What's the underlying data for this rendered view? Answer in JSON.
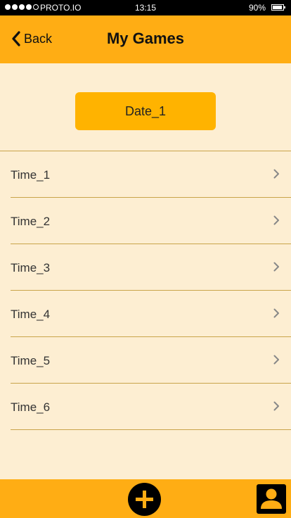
{
  "status_bar": {
    "carrier": "PROTO.IO",
    "time": "13:15",
    "battery": "90%",
    "battery_level": 0.9,
    "signal_bars": 4
  },
  "nav": {
    "back_label": "Back",
    "title": "My Games"
  },
  "date_button": {
    "label": "Date_1"
  },
  "times": [
    {
      "label": "Time_1"
    },
    {
      "label": "Time_2"
    },
    {
      "label": "Time_3"
    },
    {
      "label": "Time_4"
    },
    {
      "label": "Time_5"
    },
    {
      "label": "Time_6"
    }
  ],
  "tab_bar": {
    "add_icon": "plus-circle-icon",
    "profile_icon": "person-icon"
  },
  "colors": {
    "accent": "#ffad14",
    "button": "#ffb300",
    "background": "#fdeed2",
    "divider": "#c9a44a"
  }
}
